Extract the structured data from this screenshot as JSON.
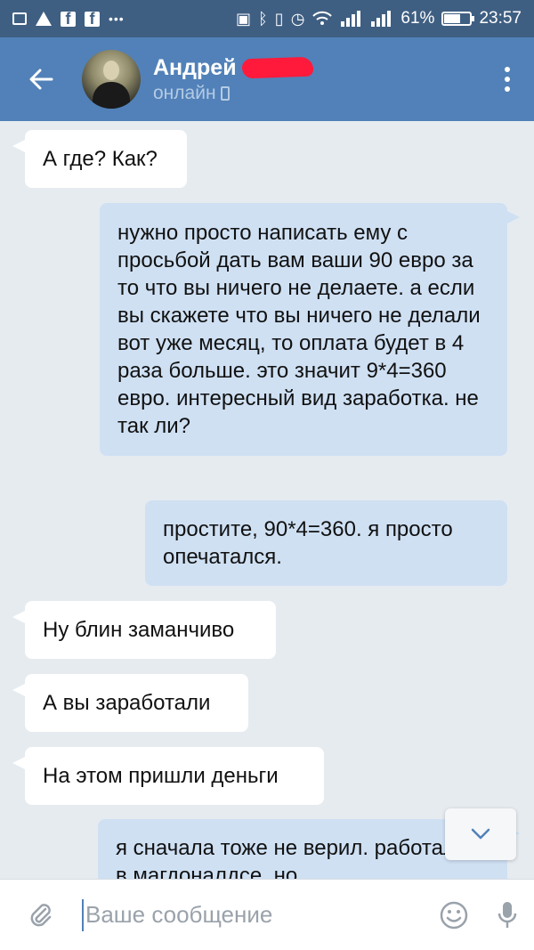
{
  "status_bar": {
    "left_icons": [
      "image-icon",
      "warning-icon",
      "facebook-icon",
      "facebook-icon",
      "more-icon"
    ],
    "right_icons": [
      "nfc-icon",
      "bluetooth-icon",
      "vibrate-icon",
      "alarm-icon",
      "wifi-icon",
      "signal-icon",
      "signal-icon"
    ],
    "battery": "61%",
    "battery_level": 0.61,
    "time": "23:57"
  },
  "header": {
    "name": "Андрей",
    "status": "онлайн"
  },
  "messages": [
    {
      "direction": "in",
      "text": "А где? Как?"
    },
    {
      "direction": "out",
      "text": "нужно просто написать ему с просьбой дать вам ваши 90 евро за то что вы ничего не делаете. а если вы скажете что вы ничего не делали вот уже месяц, то оплата будет в 4 раза больше. это значит 9*4=360 евро. интересный вид заработка. не так ли?"
    },
    {
      "direction": "out",
      "text": "простите, 90*4=360. я просто опечатался."
    },
    {
      "direction": "in",
      "text": "Ну блин заманчиво"
    },
    {
      "direction": "in",
      "text": "А вы заработали"
    },
    {
      "direction": "in",
      "text": "На этом пришли деньги"
    },
    {
      "direction": "out",
      "text": "я сначала тоже не верил. работал на в магдоналдсе, но"
    }
  ],
  "input": {
    "placeholder": "Ваше сообщение"
  },
  "colors": {
    "status_bar": "#3f5f82",
    "header": "#5181b8",
    "chat_bg": "#e6ebf0",
    "incoming": "#ffffff",
    "outgoing": "#cfe0f3",
    "redaction": "#ff1a3c"
  }
}
